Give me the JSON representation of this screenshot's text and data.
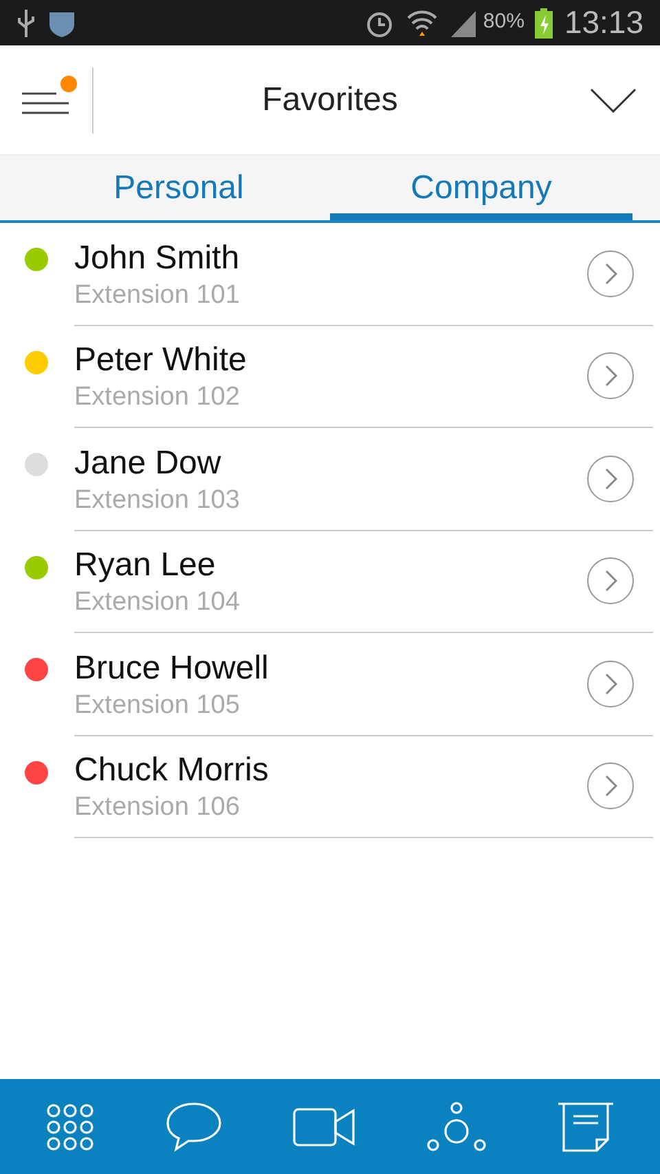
{
  "status_bar": {
    "battery": "80%",
    "time": "13:13"
  },
  "header": {
    "title": "Favorites",
    "menu_badge": true
  },
  "tabs": [
    {
      "label": "Personal",
      "selected": false
    },
    {
      "label": "Company",
      "selected": true
    }
  ],
  "contacts": [
    {
      "name": "John Smith",
      "extension": "Extension 101",
      "color": "#99cc00"
    },
    {
      "name": "Peter White",
      "extension": "Extension 102",
      "color": "#ffcc00"
    },
    {
      "name": "Jane Dow",
      "extension": "Extension 103",
      "color": "#dddddd"
    },
    {
      "name": "Ryan Lee",
      "extension": "Extension 104",
      "color": "#99cc00"
    },
    {
      "name": "Bruce Howell",
      "extension": "Extension 105",
      "color": "#ff4444"
    },
    {
      "name": "Chuck Morris",
      "extension": "Extension 106",
      "color": "#ff4444"
    }
  ],
  "bottom_nav": [
    {
      "kind": "dialpad"
    },
    {
      "kind": "chat"
    },
    {
      "kind": "video"
    },
    {
      "kind": "conference"
    },
    {
      "kind": "notes"
    }
  ]
}
